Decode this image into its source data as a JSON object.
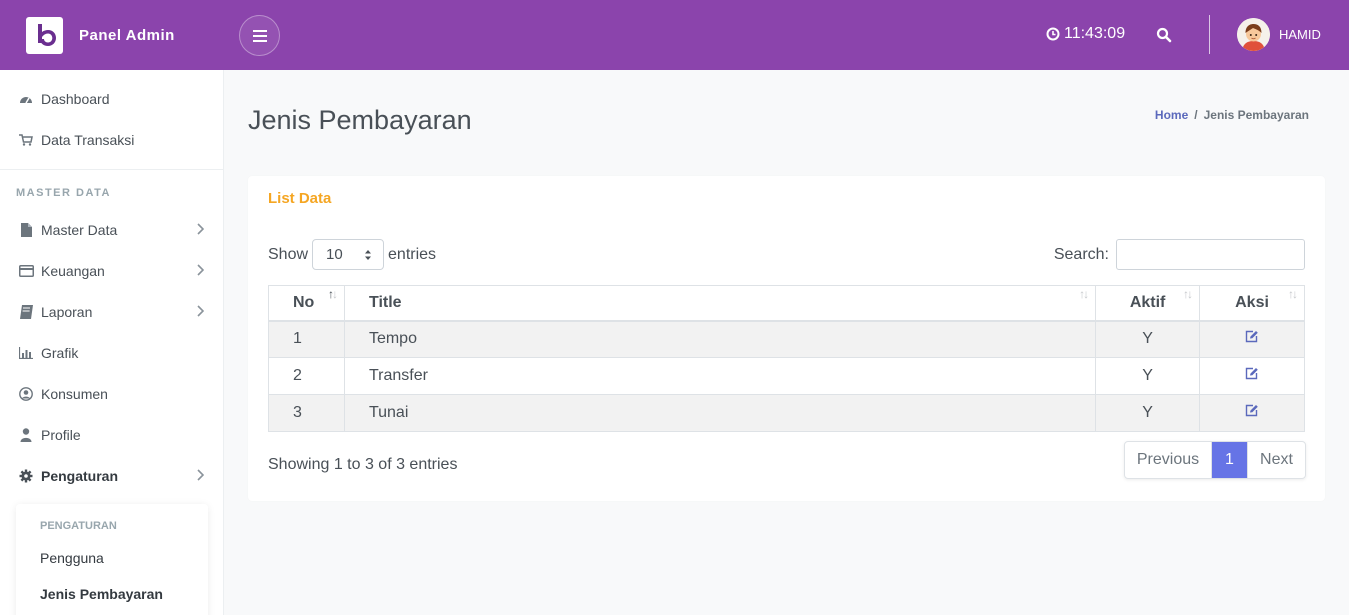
{
  "header": {
    "brand_name": "Panel Admin",
    "time": "11:43:09",
    "username": "HAMID",
    "bg_color": "#8b44ac"
  },
  "sidebar": {
    "items": [
      {
        "label": "Dashboard",
        "icon": "dashboard-icon"
      },
      {
        "label": "Data Transaksi",
        "icon": "cart-icon"
      }
    ],
    "section_heading": "MASTER DATA",
    "section_items": [
      {
        "label": "Master Data",
        "icon": "file-icon",
        "has_submenu": true
      },
      {
        "label": "Keuangan",
        "icon": "credit-card-icon",
        "has_submenu": true
      },
      {
        "label": "Laporan",
        "icon": "book-icon",
        "has_submenu": true
      },
      {
        "label": "Grafik",
        "icon": "bar-chart-icon",
        "has_submenu": false
      },
      {
        "label": "Konsumen",
        "icon": "user-circle-icon",
        "has_submenu": false
      },
      {
        "label": "Profile",
        "icon": "user-icon",
        "has_submenu": false
      },
      {
        "label": "Pengaturan",
        "icon": "gear-icon",
        "has_submenu": true,
        "expanded": true
      }
    ],
    "submenu": {
      "heading": "PENGATURAN",
      "items": [
        {
          "label": "Pengguna",
          "active": false
        },
        {
          "label": "Jenis Pembayaran",
          "active": true
        }
      ]
    }
  },
  "page": {
    "title": "Jenis Pembayaran",
    "breadcrumb": {
      "home": "Home",
      "separator": "/",
      "current": "Jenis Pembayaran"
    }
  },
  "card": {
    "title": "List Data",
    "title_color": "#f5a623",
    "length": {
      "show_label": "Show",
      "value": "10",
      "entries_label": "entries"
    },
    "search": {
      "label": "Search:",
      "value": ""
    },
    "table": {
      "headers": [
        "No",
        "Title",
        "Aktif",
        "Aksi"
      ],
      "rows": [
        {
          "no": "1",
          "title": "Tempo",
          "aktif": "Y",
          "aksi": "edit-icon"
        },
        {
          "no": "2",
          "title": "Transfer",
          "aktif": "Y",
          "aksi": "edit-icon"
        },
        {
          "no": "3",
          "title": "Tunai",
          "aktif": "Y",
          "aksi": "edit-icon"
        }
      ]
    },
    "info": "Showing 1 to 3 of 3 entries",
    "pagination": {
      "previous": "Previous",
      "current": "1",
      "next": "Next",
      "active_color": "#6674e6"
    }
  }
}
